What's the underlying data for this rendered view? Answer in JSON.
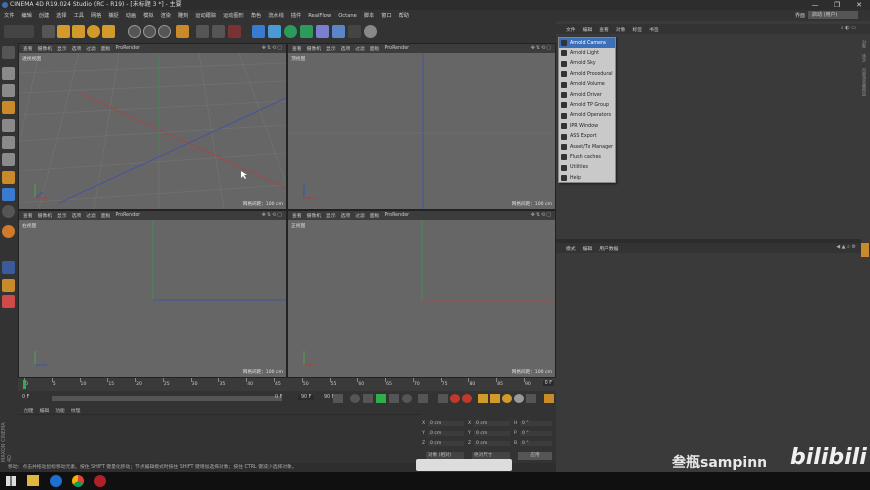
{
  "window": {
    "title": "CINEMA 4D R19.024 Studio (RC - R19) - [未标题 3 *] - 主要",
    "controls": [
      "—",
      "❐",
      "✕"
    ]
  },
  "menubar": {
    "items": [
      "文件",
      "编辑",
      "创建",
      "选择",
      "工具",
      "网格",
      "捕捉",
      "动画",
      "模拟",
      "渲染",
      "雕刻",
      "运动跟踪",
      "运动图形",
      "角色",
      "流水线",
      "插件",
      "RealFlow",
      "Octane",
      "脚本",
      "窗口",
      "帮助"
    ],
    "layout_label": "界面",
    "layout_value": "启动 (用户)"
  },
  "viewports": [
    {
      "name": "透视视图",
      "scale": "网格间距：100 cm",
      "menu": [
        "查看",
        "摄像机",
        "显示",
        "选项",
        "过滤",
        "面板",
        "ProRender"
      ]
    },
    {
      "name": "顶视图",
      "scale": "网格间距：100 cm",
      "menu": [
        "查看",
        "摄像机",
        "显示",
        "选项",
        "过滤",
        "面板",
        "ProRender"
      ]
    },
    {
      "name": "右视图",
      "scale": "网格间距：100 cm",
      "menu": [
        "查看",
        "摄像机",
        "显示",
        "选项",
        "过滤",
        "面板",
        "ProRender"
      ]
    },
    {
      "name": "正视图",
      "scale": "网格间距：100 cm",
      "menu": [
        "查看",
        "摄像机",
        "显示",
        "选项",
        "过滤",
        "面板",
        "ProRender"
      ]
    }
  ],
  "timeline": {
    "ticks": [
      "0",
      "5",
      "10",
      "15",
      "20",
      "25",
      "30",
      "35",
      "40",
      "45",
      "50",
      "55",
      "60",
      "65",
      "70",
      "75",
      "80",
      "85",
      "90"
    ],
    "end_label": "0 F",
    "start_field": "0 F",
    "current_field": "0 F",
    "end_field": "90 F",
    "max_field": "90 F"
  },
  "material_panel": {
    "menu": [
      "创建",
      "编辑",
      "功能",
      "纹理"
    ]
  },
  "coord_panel": {
    "rows": [
      {
        "axis": "X",
        "pos": "0 cm",
        "size": "0 cm",
        "rot_label": "H",
        "rot": "0 °"
      },
      {
        "axis": "Y",
        "pos": "0 cm",
        "size": "0 cm",
        "rot_label": "P",
        "rot": "0 °"
      },
      {
        "axis": "Z",
        "pos": "0 cm",
        "size": "0 cm",
        "rot_label": "B",
        "rot": "0 °"
      }
    ],
    "mode1": "对象 (相对)",
    "mode2": "绝对尺寸",
    "apply": "应用"
  },
  "status": {
    "text": "移动：点击并拖动鼠标移动元素。按住 SHIFT 键量化移动；节点编辑模式时按住 SHIFT 键增加选择对象；按住 CTRL 键减少选择对象。"
  },
  "object_manager": {
    "menu": [
      "文件",
      "编辑",
      "查看",
      "对象",
      "标签",
      "书签"
    ]
  },
  "attribute_manager": {
    "menu": [
      "模式",
      "编辑",
      "用户数据"
    ]
  },
  "arnold_menu": {
    "items": [
      "Arnold Camera",
      "Arnold Light",
      "Arnold Sky",
      "Arnold Procedural",
      "Arnold Volume",
      "Arnold Driver",
      "Arnold TP Group",
      "Arnold Operators",
      "IPR Window",
      "ASS Export",
      "Asset/Tx Manager",
      "Flush caches",
      "Utilities",
      "Help"
    ],
    "highlighted_index": 0
  },
  "side_tabs": [
    "对象",
    "场次",
    "内容浏览器",
    "构造"
  ],
  "watermark": {
    "text": "叁瓶sampinn",
    "logo": "bilibili"
  },
  "maxon_label": "MAXON CINEMA 4D",
  "colors": {
    "viewport_bg": "#666666",
    "highlight": "#3b6fb7",
    "x_axis": "#c0392b",
    "y_axis": "#27ae60",
    "z_axis": "#2e4fc0"
  }
}
